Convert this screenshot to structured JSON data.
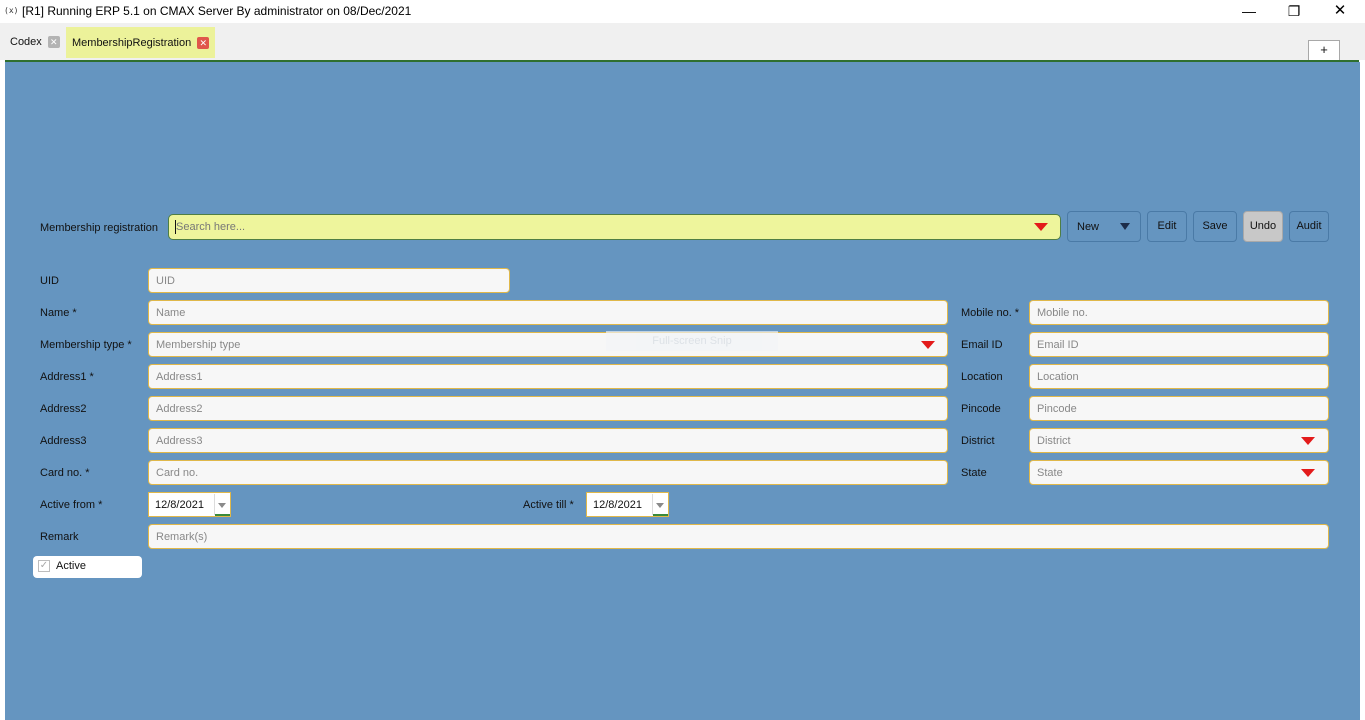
{
  "window": {
    "app_icon": "(x)",
    "title": "[R1] Running ERP 5.1 on CMAX Server By administrator on 08/Dec/2021",
    "minimize": "—",
    "maximize": "❐",
    "close": "✕"
  },
  "tabs": [
    {
      "label": "Codex",
      "close": "✕"
    },
    {
      "label": "MembershipRegistration",
      "close": "✕"
    }
  ],
  "tab_add": "+",
  "toolbar": {
    "search_label": "Membership registration",
    "search_placeholder": "Search here...",
    "new": "New",
    "edit": "Edit",
    "save": "Save",
    "undo": "Undo",
    "audit": "Audit"
  },
  "form": {
    "uid": {
      "label": "UID",
      "placeholder": "UID"
    },
    "name": {
      "label": "Name  *",
      "placeholder": "Name"
    },
    "membership_type": {
      "label": "Membership type  *",
      "placeholder": "Membership type"
    },
    "address1": {
      "label": "Address1  *",
      "placeholder": "Address1"
    },
    "address2": {
      "label": "Address2",
      "placeholder": "Address2"
    },
    "address3": {
      "label": "Address3",
      "placeholder": "Address3"
    },
    "card_no": {
      "label": "Card no. *",
      "placeholder": "Card no."
    },
    "mobile": {
      "label": "Mobile no. *",
      "placeholder": "Mobile no."
    },
    "email": {
      "label": "Email ID",
      "placeholder": "Email ID"
    },
    "location": {
      "label": "Location",
      "placeholder": "Location"
    },
    "pincode": {
      "label": "Pincode",
      "placeholder": "Pincode"
    },
    "district": {
      "label": "District",
      "placeholder": "District"
    },
    "state": {
      "label": "State",
      "placeholder": "State"
    },
    "active_from": {
      "label": "Active from *",
      "value": "12/8/2021"
    },
    "active_till": {
      "label": "Active till *",
      "value": "12/8/2021"
    },
    "remark": {
      "label": "Remark",
      "placeholder": "Remark(s)"
    },
    "active": {
      "label": "Active",
      "checked": true
    }
  },
  "overlay": {
    "snip_text": "Full-screen Snip"
  },
  "colors": {
    "background": "#6595c0",
    "field_bg": "#f7f7f7",
    "field_border": "#e0b84a",
    "search_bg": "#eef59c",
    "dropdown_arrow": "#e31b1b",
    "active_tab": "#ecf29a"
  }
}
